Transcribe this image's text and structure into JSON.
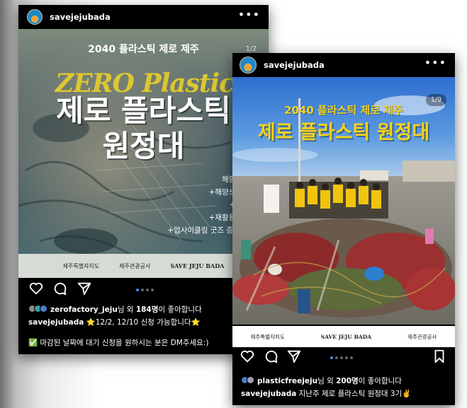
{
  "post_left": {
    "username": "savejejubada",
    "more": "•••",
    "image": {
      "subtitle": "2040 플라스틱 제로 제주",
      "title_line1": "제로 플라스틱",
      "title_line2": "원정대",
      "bg_text": "ZERO Plastic",
      "counter": "1/2",
      "items": [
        "해양환경교육",
        "+해양쓰레기건사",
        "+비치클린",
        "+재활용공장견학",
        "+업사이클링 굿즈 증정 패키지"
      ],
      "logos": [
        "제주특별자치도",
        "제주관광공사",
        "SAVE JEJU BADA"
      ]
    },
    "likes": {
      "user": "zerofactory_jeju",
      "text_mid": "님 외 ",
      "count": "184명",
      "text_end": "이 좋아합니다"
    },
    "caption": {
      "user": "savejejubada",
      "text": " ⭐12/2, 12/10 신청 가능합니다⭐"
    },
    "note": "✅ 마감된 날짜에 대기 신청을 원하시는 분은 DM주세요:)"
  },
  "post_right": {
    "username": "savejejubada",
    "more": "•••",
    "image": {
      "subtitle": "2040 플라스틱 제로 제주",
      "title": "제로 플라스틱 원정대",
      "counter": "1/9",
      "logos": [
        "제주특별자치도",
        "SAVE JEJU BADA",
        "제주관광공사"
      ]
    },
    "likes": {
      "user": "plasticfreejeju",
      "text_mid": "님 외 ",
      "count": "200명",
      "text_end": "이 좋아합니다"
    },
    "caption": {
      "user": "savejejubada",
      "text": " 지난주 제로 플라스틱 원정대 3기✌️"
    }
  }
}
